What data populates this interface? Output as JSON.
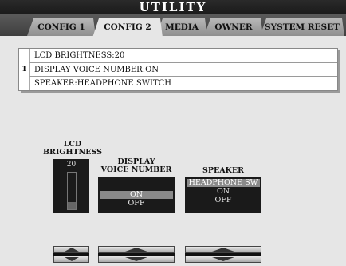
{
  "title": "UTILITY",
  "tabs": [
    {
      "label": "CONFIG 1"
    },
    {
      "label": "CONFIG 2"
    },
    {
      "label": "MEDIA"
    },
    {
      "label": "OWNER"
    },
    {
      "label": "SYSTEM RESET"
    }
  ],
  "active_tab": "CONFIG 2",
  "settings_list": {
    "index": "1",
    "rows": [
      "LCD BRIGHTNESS:20",
      "DISPLAY VOICE NUMBER:ON",
      "SPEAKER:HEADPHONE SWITCH"
    ]
  },
  "controls": {
    "lcd_brightness": {
      "label_line1": "LCD",
      "label_line2": "BRIGHTNESS",
      "value": "20",
      "level": 0.2
    },
    "display_voice_number": {
      "label_line1": "DISPLAY",
      "label_line2": "VOICE NUMBER",
      "options": [
        "ON",
        "OFF"
      ],
      "selected": "ON"
    },
    "speaker": {
      "label": "SPEAKER",
      "options": [
        "HEADPHONE SW",
        "ON",
        "OFF"
      ],
      "selected": "HEADPHONE SW"
    }
  },
  "icons": {
    "up": "triangle-up-icon",
    "down": "triangle-down-icon"
  },
  "colors": {
    "background": "#e6e6e6",
    "title_bar": "#1a1a1a",
    "tab_active": "#e6e6e6",
    "tab_inactive": "#a0a0a0",
    "selected_option": "#8a8a8a"
  }
}
